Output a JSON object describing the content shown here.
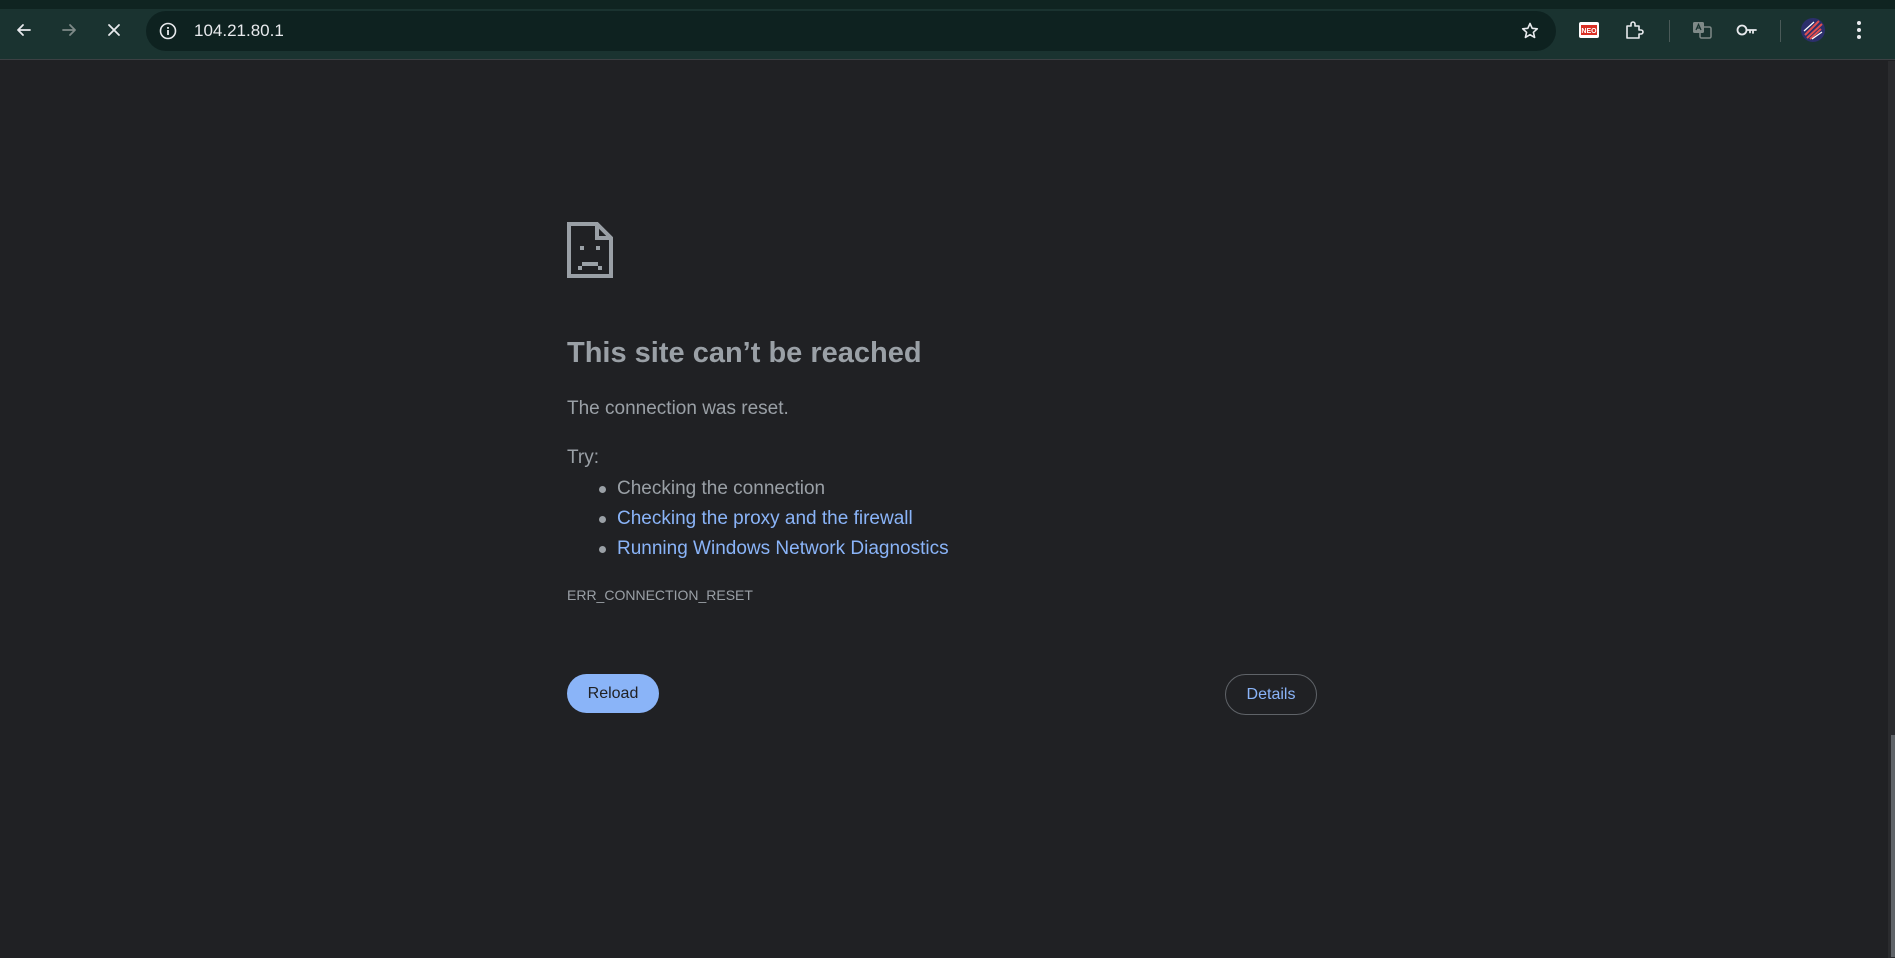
{
  "browser": {
    "url": "104.21.80.1",
    "icons": {
      "back": "arrow-left-icon",
      "forward": "arrow-right-icon",
      "stop": "close-icon",
      "site_info": "info-icon",
      "bookmark": "star-icon",
      "extension_1": "neo-extension-icon",
      "extensions": "puzzle-icon",
      "translate": "translate-icon",
      "passwords": "key-icon",
      "profile": "avatar",
      "menu": "kebab-menu-icon"
    },
    "extension_badge": "NEO"
  },
  "error_page": {
    "title": "This site can’t be reached",
    "subtitle": "The connection was reset.",
    "try_label": "Try:",
    "suggestions": [
      {
        "text": "Checking the connection",
        "is_link": false
      },
      {
        "text": "Checking the proxy and the firewall",
        "is_link": true
      },
      {
        "text": "Running Windows Network Diagnostics",
        "is_link": true
      }
    ],
    "error_code": "ERR_CONNECTION_RESET",
    "reload_label": "Reload",
    "details_label": "Details"
  },
  "colors": {
    "toolbar_bg": "#1a3330",
    "page_bg": "#202124",
    "text": "#9aa0a6",
    "link": "#8ab4f8",
    "primary_button": "#8ab4f8"
  }
}
